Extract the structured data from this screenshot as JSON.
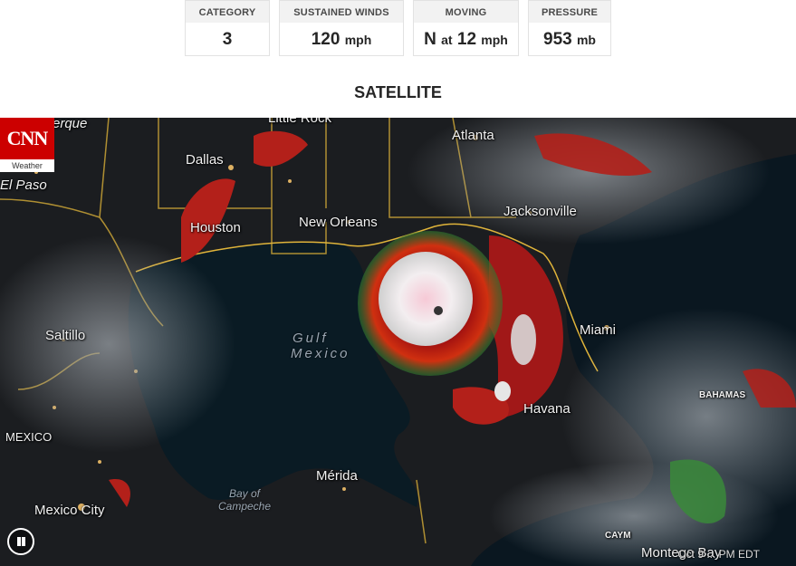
{
  "stats": [
    {
      "label": "CATEGORY",
      "value": "3",
      "unit": ""
    },
    {
      "label": "SUSTAINED WINDS",
      "value": "120",
      "unit": "mph"
    },
    {
      "label": "MOVING",
      "value": "N",
      "mid": "at",
      "value2": "12",
      "unit": "mph"
    },
    {
      "label": "PRESSURE",
      "value": "953",
      "unit": "mb"
    }
  ],
  "section_title": "SATELLITE",
  "logo": {
    "mark": "CNN",
    "sub": "Weather",
    "color": "#cc0000"
  },
  "map": {
    "cities": {
      "little_rock": "Little Rock",
      "albuquerque": "erque",
      "dallas": "Dallas",
      "el_paso": "El Paso",
      "atlanta": "Atlanta",
      "houston": "Houston",
      "new_orleans": "New Orleans",
      "jacksonville": "Jacksonville",
      "miami": "Miami",
      "saltillo": "Saltillo",
      "havana": "Havana",
      "bahamas": "BAHAMAS",
      "mexico": "MEXICO",
      "merida": "Mérida",
      "mexico_city": "Mexico City",
      "cayman": "CAYM",
      "montego_bay": "Montego Bay"
    },
    "water": {
      "gulf_line1": "Gulf",
      "gulf_line2": "Mexico",
      "bay_line1": "Bay of",
      "bay_line2": "Campeche"
    },
    "timestamp": "Oct 9 ... PM EDT",
    "controls": {
      "pause_icon": "pause-icon"
    }
  }
}
